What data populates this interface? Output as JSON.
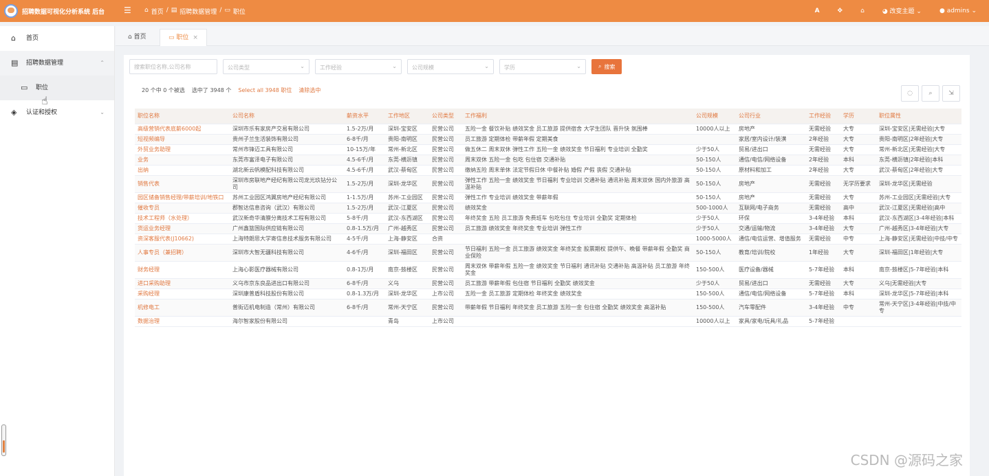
{
  "header": {
    "title": "招聘数据可视化分析系统 后台",
    "breadcrumb": [
      "首页",
      "招聘数据管理",
      "职位"
    ],
    "theme_label": "改变主题",
    "user_label": "admins",
    "font_icon_label": "A"
  },
  "tabs": {
    "home": "首页",
    "active": "职位"
  },
  "sidebar": {
    "items": [
      {
        "label": "首页",
        "icon": "home-icon"
      },
      {
        "label": "招聘数据管理",
        "icon": "database-icon"
      },
      {
        "label": "职位",
        "icon": "job-icon"
      },
      {
        "label": "认证和授权",
        "icon": "shield-icon"
      }
    ]
  },
  "filters": {
    "search_placeholder": "搜索职位名称,公司名称",
    "company_type": "公司类型",
    "experience": "工作经验",
    "company_scale": "公司规模",
    "education": "学历",
    "search_button": "搜索"
  },
  "selection": {
    "count_text": "20 个中 0 个被选",
    "selected_text": "选中了 3948 个",
    "select_all": "Select all 3948 职位",
    "clear": "清除选中"
  },
  "table": {
    "columns": [
      "职位名称",
      "公司名称",
      "薪资水平",
      "工作地区",
      "公司类型",
      "工作福利",
      "公司规模",
      "公司行业",
      "工作经验",
      "学历",
      "职位属性"
    ],
    "rows": [
      [
        "高级营销代表底薪6000起",
        "深圳市乐有家房产交易有限公司",
        "1.5-2万/月",
        "深圳-宝安区",
        "民营公司",
        "五险一金 餐饮补贴 绩效奖金 员工旅游 提供宿舍 大学生团队 晋升快 氛围棒",
        "10000人以上",
        "房地产",
        "无需经验",
        "大专",
        "深圳-宝安区|无需经验|大专"
      ],
      [
        "短视频编导",
        "贵州子兰生活装饰有限公司",
        "6-8千/月",
        "贵阳-南明区",
        "民营公司",
        "员工旅游 定期体检 带薪年假 定期美食",
        "",
        "家居/室内设计/装潢",
        "2年经验",
        "大专",
        "贵阳-南明区|2年经验|大专"
      ],
      [
        "外贸业务助理",
        "常州市锋迈工具有限公司",
        "10-15万/年",
        "常州-新北区",
        "民营公司",
        "做五休二 周末双休 弹性工作 五险一金 绩效奖金 节日福利 专业培训 全勤奖",
        "少于50人",
        "贸易/进出口",
        "无需经验",
        "大专",
        "常州-新北区|无需经验|大专"
      ],
      [
        "业务",
        "东莞市富泽电子有限公司",
        "4.5-6千/月",
        "东莞-横沥镇",
        "民营公司",
        "周末双休 五险一金 包吃 包住宿 交通补贴",
        "50-150人",
        "通信/电信/网络设备",
        "2年经验",
        "本科",
        "东莞-横沥镇|2年经验|本科"
      ],
      [
        "出纳",
        "湖北新云帆模配科技有限公司",
        "4.5-6千/月",
        "武汉-蔡甸区",
        "民营公司",
        "缴纳五险 周末单休 法定节假日休 中餐补贴 婚假 产假 丧假 交通补贴",
        "50-150人",
        "原材料和加工",
        "2年经验",
        "大专",
        "武汉-蔡甸区|2年经验|大专"
      ],
      [
        "销售代表",
        "深圳市房联地产经纪有限公司龙光玖钻分公司",
        "1.5-2万/月",
        "深圳-龙华区",
        "民营公司",
        "弹性工作 五险一金 绩效奖金 节日福利 专业培训 交通补贴 通讯补贴 周末双休 国内外旅游 高温补贴",
        "50-150人",
        "房地产",
        "无需经验",
        "无学历要求",
        "深圳-龙华区|无需经验"
      ],
      [
        "园区储备销售经理/带薪培训/地铁口",
        "苏州工业园区鸿翼房地产经纪有限公司",
        "1-1.5万/月",
        "苏州-工业园区",
        "民营公司",
        "弹性工作 专业培训 绩效奖金 带薪年假",
        "50-150人",
        "房地产",
        "无需经验",
        "大专",
        "苏州-工业园区|无需经验|大专"
      ],
      [
        "催收专员",
        "郡智达信息咨询（武汉）有限公司",
        "1.5-2万/月",
        "武汉-江夏区",
        "民营公司",
        "绩效奖金",
        "500-1000人",
        "互联网/电子商务",
        "无需经验",
        "高中",
        "武汉-江夏区|无需经验|高中"
      ],
      [
        "技术工程师（水处理）",
        "武汉新奇华清膜分离技术工程有限公司",
        "5-8千/月",
        "武汉-东西湖区",
        "民营公司",
        "年终奖金 五险 员工旅游 免费班车 包吃包住 专业培训 全勤奖 定期体检",
        "少于50人",
        "环保",
        "3-4年经验",
        "本科",
        "武汉-东西湖区|3-4年经验|本科"
      ],
      [
        "货运业务经理",
        "广州鑫篮国际供应链有限公司",
        "0.8-1.5万/月",
        "广州-越秀区",
        "民营公司",
        "员工旅游 绩效奖金 年终奖金 专业培训 弹性工作",
        "少于50人",
        "交通/运输/物流",
        "3-4年经验",
        "大专",
        "广州-越秀区|3-4年经验|大专"
      ],
      [
        "资深客服代表(J10662)",
        "上海特朗思大学寄信息技术服务有限公司",
        "4-5千/月",
        "上海-静安区",
        "合资",
        "",
        "1000-5000人",
        "通信/电信运营、增值服务",
        "无需经验",
        "中专",
        "上海-静安区|无需经验|中技/中专"
      ],
      [
        "人事专员（兼招聘）",
        "深圳市大智无疆科技有限公司",
        "4-6千/月",
        "深圳-福田区",
        "民营公司",
        "节日福利 五险一金 员工旅游 绩效奖金 年终奖金 股票期权 提供午、晚餐 带薪年假 全勤奖 商业保险",
        "50-150人",
        "教育/培训/院校",
        "1年经验",
        "大专",
        "深圳-福田区|1年经验|大专"
      ],
      [
        "财务经理",
        "上海心影医疗器械有限公司",
        "0.8-1万/月",
        "南京-鼓楼区",
        "民营公司",
        "周末双休 带薪年假 五险一金 绩效奖金 节日福利 通讯补贴 交通补贴 高温补贴 员工旅游 年终奖金",
        "150-500人",
        "医疗设备/器械",
        "5-7年经验",
        "本科",
        "南京-鼓楼区|5-7年经验|本科"
      ],
      [
        "进口采购助理",
        "义乌市京东良品进出口有限公司",
        "6-8千/月",
        "义乌",
        "民营公司",
        "员工旅游 带薪年假 包住宿 节日福利 全勤奖 绩效奖金",
        "少于50人",
        "贸易/进出口",
        "无需经验",
        "大专",
        "义乌|无需经验|大专"
      ],
      [
        "采购经理",
        "深圳康普盾科技股份有限公司",
        "0.8-1.3万/月",
        "深圳-龙华区",
        "上市公司",
        "五险一金 员工旅游 定期体检 年终奖金 绩效奖金",
        "150-500人",
        "通信/电信/网络设备",
        "5-7年经验",
        "本科",
        "深圳-龙华区|5-7年经验|本科"
      ],
      [
        "机修电工",
        "普街迈机电制造（常州）有限公司",
        "6-8千/月",
        "常州-天宁区",
        "民营公司",
        "带薪年假 节日福利 年终奖金 员工旅游 五险一金 包住宿 全勤奖 绩效奖金 高温补贴",
        "150-500人",
        "汽车零配件",
        "3-4年经验",
        "中专",
        "常州-天宁区|3-4年经验|中技/中专"
      ],
      [
        "数据治理",
        "海尔智家股份有限公司",
        "",
        "青岛",
        "上市公司",
        "",
        "10000人以上",
        "家具/家电/玩具/礼品",
        "5-7年经验",
        "",
        ""
      ]
    ]
  },
  "watermark": "CSDN @源码之家",
  "colors": {
    "accent": "#ee8b43",
    "link": "#e07840",
    "button": "#e8743c"
  }
}
